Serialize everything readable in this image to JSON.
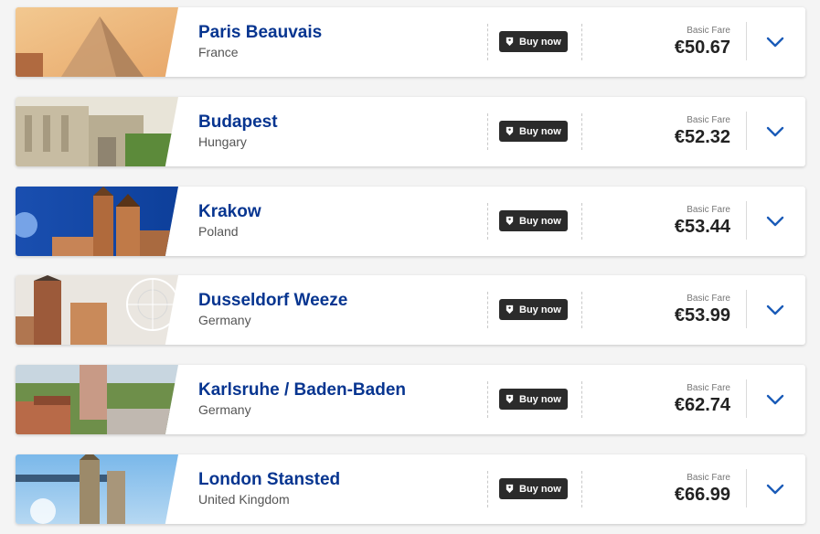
{
  "results": [
    {
      "city": "Paris Beauvais",
      "country": "France",
      "buy_label": "Buy now",
      "fare_label": "Basic Fare",
      "price": "€50.67",
      "image": "louvre-pyramid"
    },
    {
      "city": "Budapest",
      "country": "Hungary",
      "buy_label": "Buy now",
      "fare_label": "Basic Fare",
      "price": "€52.32",
      "image": "fishermans-bastion"
    },
    {
      "city": "Krakow",
      "country": "Poland",
      "buy_label": "Buy now",
      "fare_label": "Basic Fare",
      "price": "€53.44",
      "image": "st-marys-basilica"
    },
    {
      "city": "Dusseldorf Weeze",
      "country": "Germany",
      "buy_label": "Buy now",
      "fare_label": "Basic Fare",
      "price": "€53.99",
      "image": "ferris-wheel-tower"
    },
    {
      "city": "Karlsruhe / Baden-Baden",
      "country": "Germany",
      "buy_label": "Buy now",
      "fare_label": "Basic Fare",
      "price": "€62.74",
      "image": "baden-baden-rooftops"
    },
    {
      "city": "London Stansted",
      "country": "United Kingdom",
      "buy_label": "Buy now",
      "fare_label": "Basic Fare",
      "price": "€66.99",
      "image": "tower-bridge"
    }
  ],
  "colors": {
    "accent": "#073590",
    "chevron": "#1a5bb8",
    "button_bg": "#2b2b2b"
  }
}
